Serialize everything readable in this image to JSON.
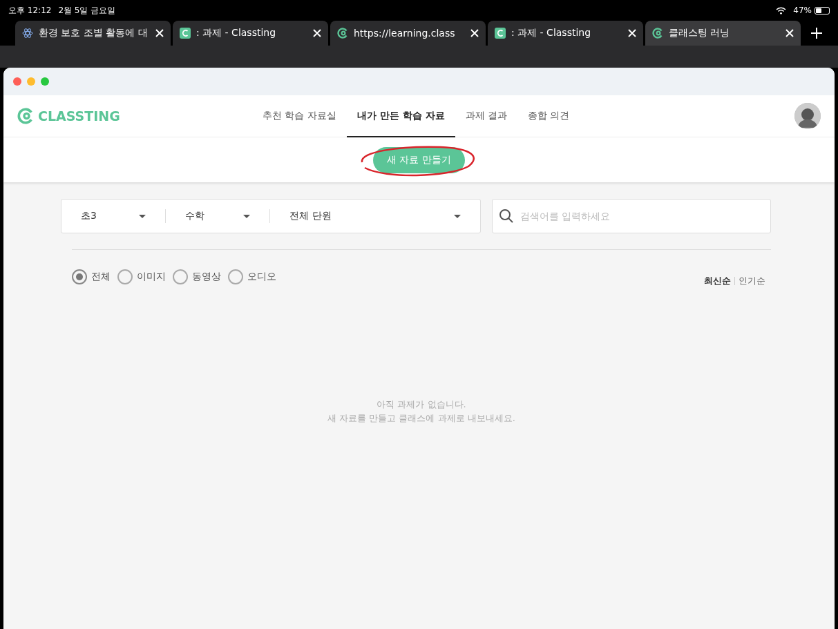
{
  "status_bar": {
    "time": "오후 12:12",
    "date": "2월 5일 금요일",
    "battery": "47%"
  },
  "browser_tabs": [
    {
      "title": "환경 보호 조별 활동에 대",
      "kind": "atom",
      "selected": false
    },
    {
      "title": ": 과제 - Classting",
      "kind": "square",
      "selected": false
    },
    {
      "title": "https://learning.class",
      "kind": "logo",
      "selected": false
    },
    {
      "title": ": 과제 - Classting",
      "kind": "square",
      "selected": false
    },
    {
      "title": "클래스팅 러닝",
      "kind": "logo",
      "selected": true
    }
  ],
  "header": {
    "logo": "CLASSTING",
    "nav": [
      {
        "label": "추천 학습 자료실",
        "selected": false
      },
      {
        "label": "내가 만든 학습 자료",
        "selected": true
      },
      {
        "label": "과제 결과",
        "selected": false
      },
      {
        "label": "종합 의견",
        "selected": false
      }
    ]
  },
  "create_button": {
    "label": "새 자료 만들기",
    "circled": true
  },
  "filters": [
    {
      "value": "초3"
    },
    {
      "value": "수학"
    },
    {
      "value": "전체 단원"
    }
  ],
  "search": {
    "placeholder": "검색어를 입력하세요"
  },
  "media_types": [
    {
      "label": "전체",
      "selected": true
    },
    {
      "label": "이미지",
      "selected": false
    },
    {
      "label": "동영상",
      "selected": false
    },
    {
      "label": "오디오",
      "selected": false
    }
  ],
  "sort": [
    {
      "label": "최신순",
      "selected": true
    },
    {
      "label": "인기순",
      "selected": false
    }
  ],
  "empty_message": [
    "아직 과제가 없습니다.",
    "새 자료를 만들고 클래스에 과제로 내보내세요."
  ]
}
